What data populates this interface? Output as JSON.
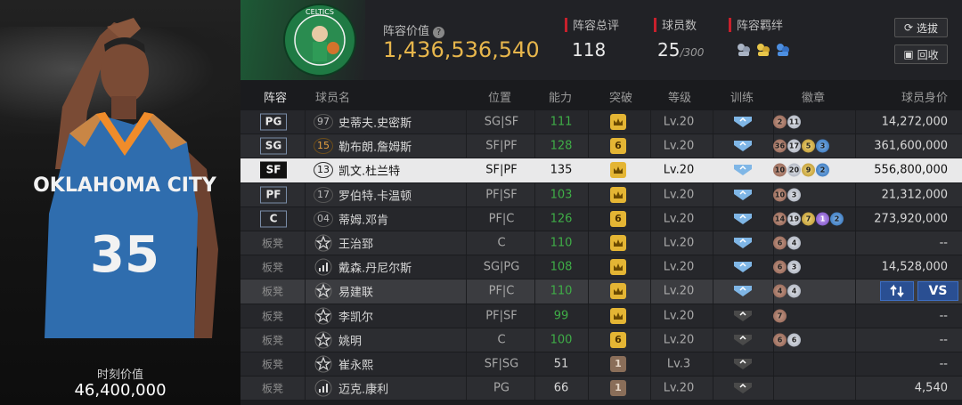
{
  "player_panel": {
    "moment_value_label": "时刻价值",
    "moment_value": "46,400,000",
    "jersey_team": "OKLAHOMA CITY",
    "jersey_number": "35"
  },
  "header": {
    "team_logo": "boston-celtics-logo",
    "lineup_value_label": "阵容价值",
    "lineup_value": "1,436,536,540",
    "total_rating_label": "阵容总评",
    "total_rating": "118",
    "player_count_label": "球员数",
    "player_count": "25",
    "player_count_max": "/300",
    "bonds_label": "阵容羁绊",
    "filter_button": "选拔",
    "recycle_button": "回收"
  },
  "columns": {
    "lineup": "阵容",
    "name": "球员名",
    "position": "位置",
    "ability": "能力",
    "breakthrough": "突破",
    "level": "等级",
    "training": "训练",
    "badges": "徽章",
    "value": "球员身价"
  },
  "rows": [
    {
      "slot": "PG",
      "bench": false,
      "marker": "97",
      "marker_type": "number",
      "name": "史蒂夫.史密斯",
      "position": "SG|SF",
      "ability": "111",
      "ability_green": true,
      "breakthrough": "crown",
      "level": "Lv.20",
      "training": "shield-blue",
      "badges": [
        [
          "bronze",
          "2"
        ],
        [
          "silver",
          "11"
        ]
      ],
      "value": "14,272,000"
    },
    {
      "slot": "SG",
      "bench": false,
      "marker": "15",
      "marker_type": "gold",
      "name": "勒布朗.詹姆斯",
      "position": "SF|PF",
      "ability": "128",
      "ability_green": true,
      "breakthrough": "6",
      "level": "Lv.20",
      "training": "shield-blue",
      "badges": [
        [
          "bronze",
          "36"
        ],
        [
          "silver",
          "17"
        ],
        [
          "gold",
          "5"
        ],
        [
          "blue",
          "3"
        ]
      ],
      "value": "361,600,000"
    },
    {
      "slot": "SF",
      "bench": false,
      "selected": true,
      "marker": "13",
      "marker_type": "number",
      "name": "凯文.杜兰特",
      "position": "SF|PF",
      "ability": "135",
      "ability_green": false,
      "breakthrough": "crown",
      "level": "Lv.20",
      "training": "shield-blue",
      "badges": [
        [
          "bronze",
          "10"
        ],
        [
          "silver",
          "20"
        ],
        [
          "gold",
          "9"
        ],
        [
          "blue",
          "2"
        ]
      ],
      "value": "556,800,000"
    },
    {
      "slot": "PF",
      "bench": false,
      "marker": "17",
      "marker_type": "number",
      "name": "罗伯特.卡温顿",
      "position": "PF|SF",
      "ability": "103",
      "ability_green": true,
      "breakthrough": "crown",
      "level": "Lv.20",
      "training": "shield-blue",
      "badges": [
        [
          "bronze",
          "10"
        ],
        [
          "silver",
          "3"
        ]
      ],
      "value": "21,312,000"
    },
    {
      "slot": "C",
      "bench": false,
      "marker": "04",
      "marker_type": "number",
      "name": "蒂姆.邓肯",
      "position": "PF|C",
      "ability": "126",
      "ability_green": true,
      "breakthrough": "6",
      "level": "Lv.20",
      "training": "shield-blue",
      "badges": [
        [
          "bronze",
          "14"
        ],
        [
          "silver",
          "19"
        ],
        [
          "gold",
          "7"
        ],
        [
          "purple",
          "1"
        ],
        [
          "blue",
          "2"
        ]
      ],
      "value": "273,920,000"
    },
    {
      "slot": "板凳",
      "bench": true,
      "marker": "star",
      "marker_type": "icon",
      "name": "王治郅",
      "position": "C",
      "ability": "110",
      "ability_green": true,
      "breakthrough": "crown",
      "level": "Lv.20",
      "training": "shield-blue",
      "badges": [
        [
          "bronze",
          "6"
        ],
        [
          "silver",
          "4"
        ]
      ],
      "value": "--"
    },
    {
      "slot": "板凳",
      "bench": true,
      "marker": "bars",
      "marker_type": "icon",
      "name": "戴森.丹尼尔斯",
      "position": "SG|PG",
      "ability": "108",
      "ability_green": true,
      "breakthrough": "crown",
      "level": "Lv.20",
      "training": "shield-blue",
      "badges": [
        [
          "bronze",
          "6"
        ],
        [
          "silver",
          "3"
        ]
      ],
      "value": "14,528,000"
    },
    {
      "slot": "板凳",
      "bench": true,
      "highlight": true,
      "marker": "star",
      "marker_type": "icon",
      "name": "易建联",
      "position": "PF|C",
      "ability": "110",
      "ability_green": true,
      "breakthrough": "crown",
      "level": "Lv.20",
      "training": "shield-blue",
      "badges": [
        [
          "bronze",
          "4"
        ],
        [
          "silver",
          "4"
        ]
      ],
      "value": "",
      "compare_label": "VS"
    },
    {
      "slot": "板凳",
      "bench": true,
      "marker": "star",
      "marker_type": "icon",
      "name": "李凯尔",
      "position": "PF|SF",
      "ability": "99",
      "ability_green": true,
      "breakthrough": "crown",
      "level": "Lv.20",
      "training": "shield-gray",
      "badges": [
        [
          "bronze",
          "7"
        ]
      ],
      "value": "--"
    },
    {
      "slot": "板凳",
      "bench": true,
      "marker": "star",
      "marker_type": "icon",
      "name": "姚明",
      "position": "C",
      "ability": "100",
      "ability_green": true,
      "breakthrough": "6",
      "level": "Lv.20",
      "training": "shield-gray",
      "badges": [
        [
          "bronze",
          "6"
        ],
        [
          "silver",
          "6"
        ]
      ],
      "value": "--"
    },
    {
      "slot": "板凳",
      "bench": true,
      "marker": "star",
      "marker_type": "icon",
      "name": "崔永熙",
      "position": "SF|SG",
      "ability": "51",
      "ability_green": false,
      "breakthrough": "1",
      "level": "Lv.3",
      "training": "shield-gray",
      "badges": [],
      "value": "--"
    },
    {
      "slot": "板凳",
      "bench": true,
      "marker": "bars",
      "marker_type": "icon",
      "name": "迈克.康利",
      "position": "PG",
      "ability": "66",
      "ability_green": false,
      "breakthrough": "1",
      "level": "Lv.20",
      "training": "shield-gray",
      "badges": [],
      "value": "4,540"
    }
  ],
  "colors": {
    "accent_gold": "#e7b64c",
    "green": "#3fae47",
    "red_marker": "#c8202c",
    "selected_row": "#e9e9ea",
    "compare_blue": "#2a4f92"
  }
}
